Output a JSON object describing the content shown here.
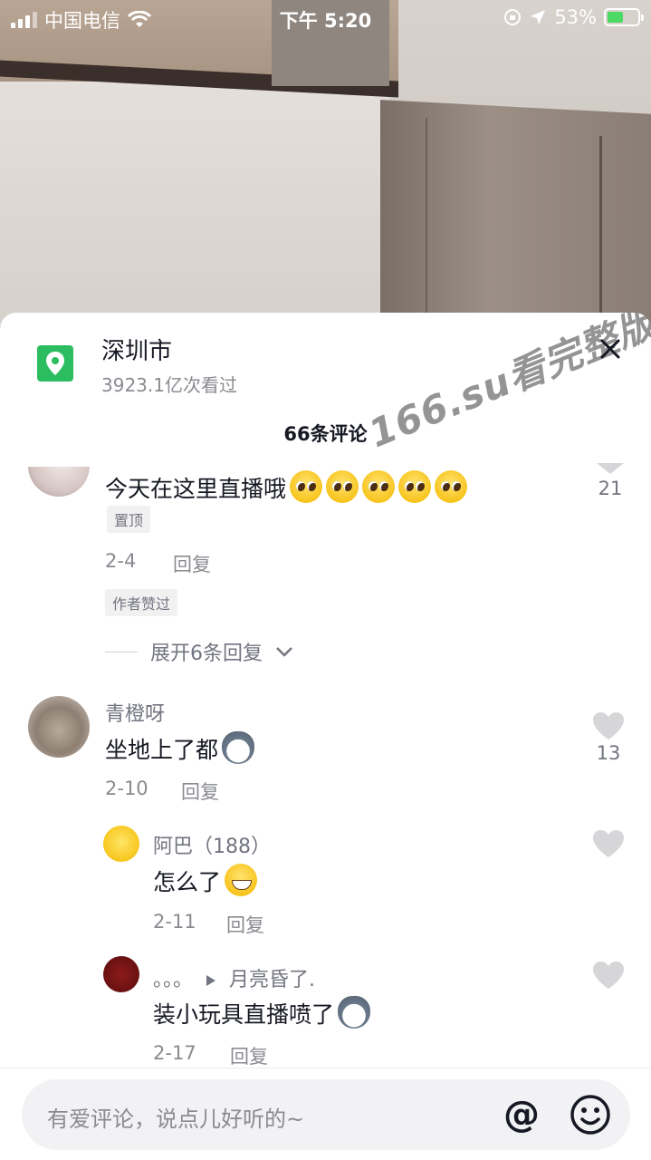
{
  "status_bar": {
    "carrier": "中国电信",
    "time": "下午 5:20",
    "battery": "53%",
    "battery_level": 0.53
  },
  "location": {
    "title": "深圳市",
    "views": "3923.1亿次看过",
    "icon": "location-pin-icon"
  },
  "watermark": "166.su看完整版",
  "comments_header": "66条评论",
  "pinned_comment": {
    "text": "今天在这里直播哦",
    "emoji_count": 5,
    "pin_tag": "置顶",
    "date": "2-4",
    "reply_label": "回复",
    "author_liked_tag": "作者赞过",
    "likes": "21",
    "expand_label": "展开6条回复"
  },
  "comments": [
    {
      "name": "青橙呀",
      "text": "坐地上了都",
      "date": "2-10",
      "reply_label": "回复",
      "likes": "13"
    }
  ],
  "replies": [
    {
      "name": "阿巴（188）",
      "text": "怎么了",
      "date": "2-11",
      "reply_label": "回复"
    },
    {
      "name": "。。。",
      "reply_to": "月亮昏了.",
      "text": "装小玩具直播喷了",
      "date": "2-17",
      "reply_label": "回复"
    }
  ],
  "input": {
    "placeholder": "有爱评论，说点儿好听的~",
    "at_symbol": "@"
  },
  "colors": {
    "location_green": "#2bbd60",
    "text_primary": "#161823",
    "text_secondary": "#8a8b91",
    "battery_green": "#4cd964"
  }
}
